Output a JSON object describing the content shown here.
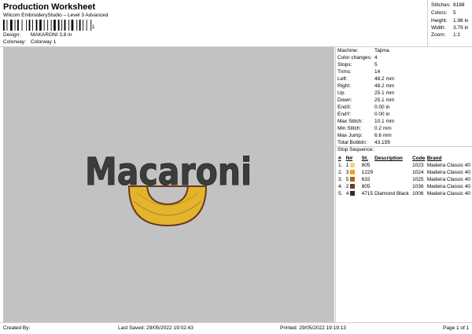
{
  "header": {
    "title": "Production Worksheet",
    "subtitle": "Wilcom EmbroideryStudio – Level 3 Advanced",
    "barcode_number": "1",
    "design_label": "Design:",
    "design_value": "MAKARONI 3,8 in",
    "colorway_label": "Colorway:",
    "colorway_value": "Colorway 1"
  },
  "stats": [
    {
      "label": "Stitches:",
      "value": "8188"
    },
    {
      "label": "Colors:",
      "value": "5"
    },
    {
      "label": "Height:",
      "value": "1.98 in"
    },
    {
      "label": "Width:",
      "value": "3.79 in"
    },
    {
      "label": "Zoom:",
      "value": "1:1"
    }
  ],
  "design": {
    "text": "Macaroni",
    "text_color": "#3b3d3a",
    "pasta_color": "#e3b52d",
    "pasta_outline": "#6a3a1c",
    "canvas_color": "#c2c2c2"
  },
  "machine_info": [
    {
      "label": "Machine:",
      "value": "Tajima"
    },
    {
      "label": "Color changes:",
      "value": "4"
    },
    {
      "label": "Stops:",
      "value": "5"
    },
    {
      "label": "Trims:",
      "value": "14"
    },
    {
      "label": "Left:",
      "value": "48.2 mm"
    },
    {
      "label": "Right:",
      "value": "48.2 mm"
    },
    {
      "label": "Up:",
      "value": "25.1 mm"
    },
    {
      "label": "Down:",
      "value": "25.1 mm"
    },
    {
      "label": "EndX:",
      "value": "0.00 in"
    },
    {
      "label": "EndY:",
      "value": "0.00 in"
    },
    {
      "label": "Max Stitch:",
      "value": "10.1 mm"
    },
    {
      "label": "Min Stitch:",
      "value": "0.2 mm"
    },
    {
      "label": "Max Jump:",
      "value": "6.6 mm"
    },
    {
      "label": "Total Bobbin:",
      "value": "43.15ft"
    }
  ],
  "stop_sequence": {
    "title": "Stop Sequence:",
    "headers": [
      "#",
      "N#",
      "St.",
      "Description",
      "Code",
      "Brand"
    ],
    "rows": [
      {
        "num": "1.",
        "needle": "1",
        "color": "#f2d389",
        "st": "805",
        "desc": "",
        "code": "1023",
        "brand": "Madeira Classic 40"
      },
      {
        "num": "2.",
        "needle": "3",
        "color": "#f0a01e",
        "st": "1229",
        "desc": "",
        "code": "1024",
        "brand": "Madeira Classic 40"
      },
      {
        "num": "3.",
        "needle": "5",
        "color": "#a2672a",
        "st": "632",
        "desc": "",
        "code": "1025",
        "brand": "Madeira Classic 40"
      },
      {
        "num": "4.",
        "needle": "2",
        "color": "#6e3b22",
        "st": "805",
        "desc": "",
        "code": "1036",
        "brand": "Madeira Classic 40"
      },
      {
        "num": "5.",
        "needle": "4",
        "color": "#2b2b2b",
        "st": "4715",
        "desc": "Diamond Black",
        "code": "1006",
        "brand": "Madeira Classic 40"
      }
    ]
  },
  "footer": {
    "created_by": "Created By:",
    "last_saved": "Last Saved: 29/05/2022 19:02:43",
    "printed": "Printed: 29/05/2022 19:19:13",
    "page": "Page 1 of 1"
  }
}
